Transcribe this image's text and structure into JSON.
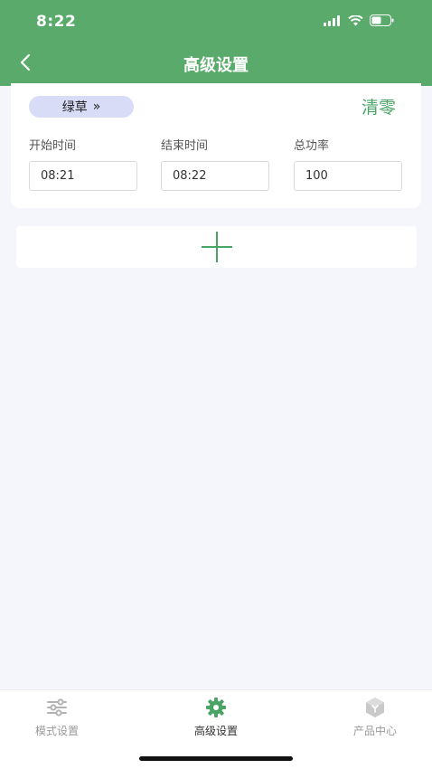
{
  "status_bar": {
    "time": "8:22"
  },
  "nav": {
    "title": "高级设置"
  },
  "card": {
    "mode_tag": "绿草",
    "mode_tag_arrow": "»",
    "clear_label": "清零",
    "fields": [
      {
        "label": "开始时间",
        "value": "08:21"
      },
      {
        "label": "结束时间",
        "value": "08:22"
      },
      {
        "label": "总功率",
        "value": "100"
      }
    ]
  },
  "add_button": {
    "icon": "plus-icon"
  },
  "tab_bar": {
    "tabs": [
      {
        "label": "模式设置",
        "icon": "sliders-icon",
        "active": false
      },
      {
        "label": "高级设置",
        "icon": "gear-icon",
        "active": true
      },
      {
        "label": "产品中心",
        "icon": "cube-icon",
        "active": false
      }
    ]
  },
  "colors": {
    "header": "#5aab6b",
    "accent": "#4aa466",
    "tag_bg": "#d9dcf6",
    "page_bg": "#f4f6fb"
  }
}
